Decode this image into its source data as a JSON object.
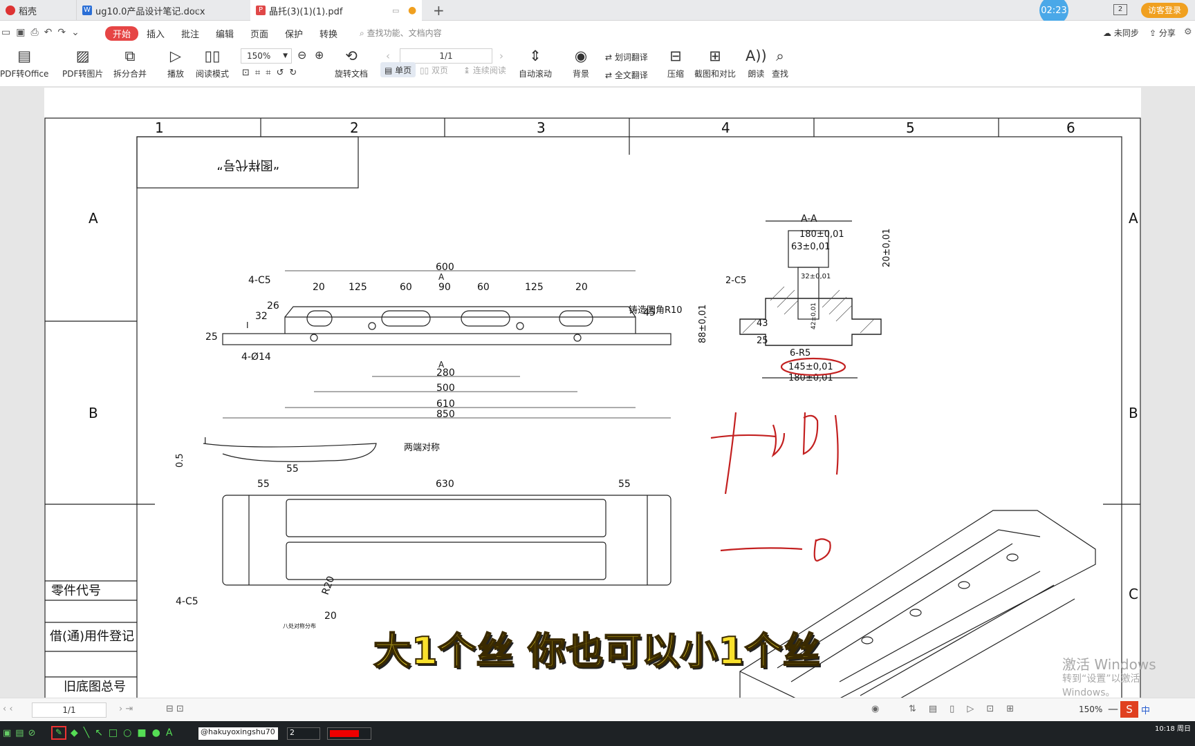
{
  "tabs": [
    {
      "label": "稻壳",
      "icon": "daoke-icon",
      "color": "#d33"
    },
    {
      "label": "ug10.0产品设计笔记.docx",
      "icon": "word-icon",
      "color": "#2b6fd6"
    },
    {
      "label": "晶托(3)(1)(1).pdf",
      "icon": "pdf-icon",
      "color": "#e04848"
    }
  ],
  "timer": "02:23",
  "tab_count": "2",
  "login": "访客登录",
  "menu": [
    "开始",
    "插入",
    "批注",
    "编辑",
    "页面",
    "保护",
    "转换"
  ],
  "search_placeholder": "查找功能、文档内容",
  "sync": "未同步",
  "share": "分享",
  "toolbar": {
    "pdf_office": "PDF转Office",
    "pdf_image": "PDF转图片",
    "split_merge": "拆分合并",
    "play": "播放",
    "read_mode": "阅读模式",
    "zoom": "150%",
    "rotate": "旋转文档",
    "page": "1/1",
    "single": "单页",
    "double": "双页",
    "continuous": "连续阅读",
    "autoscroll": "自动滚动",
    "background": "背景",
    "word_translate": "划词翻译",
    "full_translate": "全文翻译",
    "compress": "压缩",
    "screenshot_compare": "截图和对比",
    "read_aloud": "朗读",
    "find": "查找"
  },
  "drawing": {
    "col_labels": [
      "1",
      "2",
      "3",
      "4",
      "5",
      "6"
    ],
    "row_labels": [
      "A",
      "B",
      "C"
    ],
    "title_block": "“图样代号”",
    "section_label": "A-A",
    "dims_top": [
      "600",
      "4-C5",
      "20",
      "125",
      "60",
      "90",
      "60",
      "125",
      "20",
      "45",
      "铸造圆角R10",
      "32",
      "26",
      "25",
      "4-Ø14",
      "280",
      "500",
      "610",
      "850",
      "A",
      "A"
    ],
    "dims_side": [
      "180±0,01",
      "63±0,01",
      "2-C5",
      "32±0,01",
      "20±0,01",
      "88±0,01",
      "43",
      "25",
      "6-R5",
      "145±0,01",
      "180±0,01",
      "42±0,01"
    ],
    "dims_small": [
      "0.5",
      "55",
      "两端对称",
      "I",
      "I"
    ],
    "dims_bottom": [
      "55",
      "630",
      "55",
      "4-C5",
      "R20",
      "20",
      "八处对称分布"
    ],
    "side_table": [
      "零件代号",
      "借(通)用件登记",
      "旧底图总号"
    ]
  },
  "subtitle": "大1个丝 你也可以小1个丝",
  "watermark": {
    "line1": "激活 Windows",
    "line2": "转到“设置”以激活 Windows。"
  },
  "status": {
    "page": "1/1",
    "zoom": "150%"
  },
  "taskbar": {
    "font": "@hakuyoxingshu70",
    "size": "2",
    "time": "10:18 周日",
    "ime": "中"
  }
}
